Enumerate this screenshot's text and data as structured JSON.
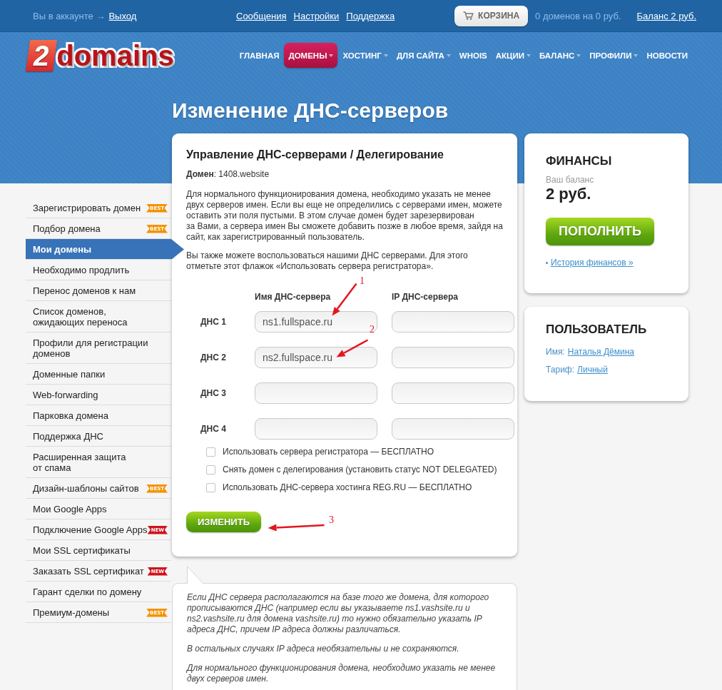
{
  "top_bar": {
    "account_label": "Вы в аккаунте →",
    "logout_link": "Выход",
    "links": [
      "Сообщения",
      "Настройки",
      "Поддержка"
    ],
    "cart_button": "КОРЗИНА",
    "cart_summary": "0 доменов на 0 руб.",
    "balance_link": "Баланс 2 руб."
  },
  "header": {
    "logo": {
      "mark": "2",
      "text": "domains"
    },
    "nav": [
      {
        "label": "ГЛАВНАЯ",
        "selected": false,
        "dropdown": false
      },
      {
        "label": "ДОМЕНЫ",
        "selected": true,
        "dropdown": true
      },
      {
        "label": "ХОСТИНГ",
        "selected": false,
        "dropdown": true
      },
      {
        "label": "ДЛЯ САЙТА",
        "selected": false,
        "dropdown": true
      },
      {
        "label": "WHOIS",
        "selected": false,
        "dropdown": false
      },
      {
        "label": "АКЦИИ",
        "selected": false,
        "dropdown": true
      },
      {
        "label": "БАЛАНС",
        "selected": false,
        "dropdown": true
      },
      {
        "label": "ПРОФИЛИ",
        "selected": false,
        "dropdown": true
      },
      {
        "label": "НОВОСТИ",
        "selected": false,
        "dropdown": false
      }
    ]
  },
  "page_title": "Изменение ДНС-серверов",
  "sidebar": {
    "items": [
      {
        "label": "Зарегистрировать домен",
        "selected": false,
        "badge": {
          "label": "BEST",
          "color": "#f39200"
        }
      },
      {
        "label": "Подбор домена",
        "selected": false,
        "badge": {
          "label": "BEST",
          "color": "#f39200"
        }
      },
      {
        "label": "Мои домены",
        "selected": true
      },
      {
        "label": "Необходимо продлить",
        "selected": false
      },
      {
        "label": "Перенос доменов к нам",
        "selected": false
      },
      {
        "label": "Список доменов,\nожидающих переноса",
        "selected": false
      },
      {
        "label": "Профили для регистрации\nдоменов",
        "selected": false
      },
      {
        "label": "Доменные папки",
        "selected": false
      },
      {
        "label": "Web-forwarding",
        "selected": false
      },
      {
        "label": "Парковка домена",
        "selected": false
      },
      {
        "label": "Поддержка ДНС",
        "selected": false
      },
      {
        "label": "Расширенная защита\nот спама",
        "selected": false
      },
      {
        "label": "Дизайн-шаблоны сайтов",
        "selected": false,
        "badge": {
          "label": "BEST",
          "color": "#f39200"
        }
      },
      {
        "label": "Мои Google Apps",
        "selected": false
      },
      {
        "label": "Подключение Google Apps",
        "selected": false,
        "badge": {
          "label": "NEW",
          "color": "#d0121b"
        }
      },
      {
        "label": "Мои SSL сертификаты",
        "selected": false
      },
      {
        "label": "Заказать SSL сертификат",
        "selected": false,
        "badge": {
          "label": "NEW",
          "color": "#d0121b"
        }
      },
      {
        "label": "Гарант сделки по домену",
        "selected": false
      },
      {
        "label": "Премиум-домены",
        "selected": false,
        "badge": {
          "label": "BEST",
          "color": "#f39200"
        }
      }
    ]
  },
  "dns_form": {
    "title": "Управление ДНС-серверами / Делегирование",
    "domain_line": "**Домен**: 1408.website",
    "paragraphs": [
      "Для нормального функционирования домена, необходимо указать не менее двух серверов имен. Если вы еще не определились с серверами имен, можете оставить эти поля пустыми. В этом случае домен будет зарезервирован за Вами, а сервера имен Вы сможете добавить позже в любое время, зайдя на сайт, как зарегистрированный пользователь.",
      "Вы также можете воспользоваться нашими ДНС серверами. Для этого отметьте этот флажок «Использовать сервера регистратора»."
    ],
    "columns": [
      "Имя ДНС-сервера",
      "IP ДНС-сервера"
    ],
    "rows": [
      {
        "label": "ДНС 1",
        "name": "ns1.fullspace.ru"
      },
      {
        "label": "ДНС 2",
        "name": "ns2.fullspace.ru"
      },
      {
        "label": "ДНС 3"
      },
      {
        "label": "ДНС 4"
      }
    ],
    "options": [
      {
        "label": "Использовать сервера регистратора — БЕСПЛАТНО",
        "checked": false
      },
      {
        "label": "Снять домен с делегирования (установить статус NOT DELEGATED)",
        "checked": false
      },
      {
        "label": "Использовать ДНС-сервера хостинга REG.RU — БЕСПЛАТНО",
        "checked": false
      }
    ],
    "submit_button": "ИЗМЕНИТЬ"
  },
  "annotations": [
    {
      "label": "1"
    },
    {
      "label": "2"
    },
    {
      "label": "3"
    }
  ],
  "finance": {
    "title": "ФИНАНСЫ",
    "balance_label": "Ваш баланс",
    "balance": "2 руб.",
    "top_up_button": "ПОПОЛНИТЬ",
    "history_link": "История финансов »"
  },
  "user": {
    "title": "ПОЛЬЗОВАТЕЛЬ",
    "fields": [
      {
        "label": "Имя:",
        "value": "Наталья Дёмина"
      },
      {
        "label": "Тариф:",
        "value": "Личный"
      }
    ]
  },
  "note": {
    "paragraphs": [
      "Если ДНС сервера располагаются на базе того же домена, для которого прописываются ДНС (например если вы указываете ns1.vashsite.ru и ns2.vashsite.ru для домена vashsite.ru) то нужно обязательно указать IP адреса ДНС, причем IP адреса должны различаться.",
      "В остальных случаях IP адреса необязательны и не сохраняются.",
      "Для нормального функционирования домена, необходимо указать не менее двух серверов имен."
    ]
  }
}
